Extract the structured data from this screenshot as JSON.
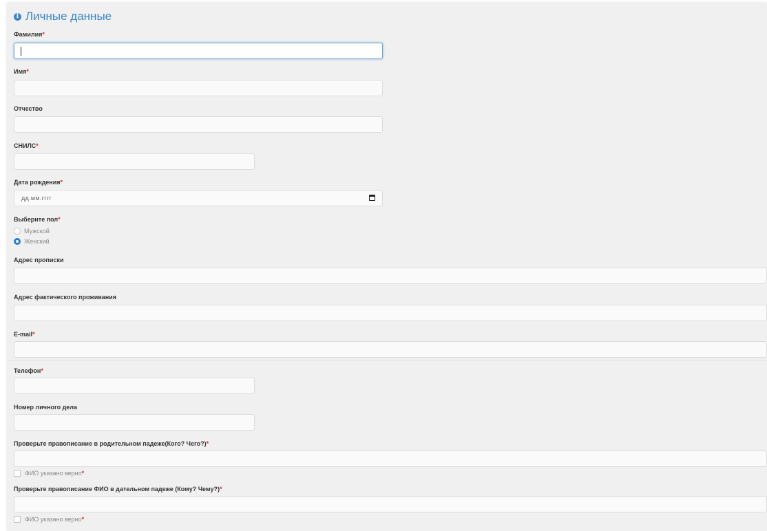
{
  "section": {
    "title": "Личные данные",
    "icon": "info-icon"
  },
  "required_mark": "*",
  "fields": {
    "last_name": {
      "label": "Фамилия",
      "value": ""
    },
    "first_name": {
      "label": "Имя",
      "value": ""
    },
    "patronymic": {
      "label": "Отчество",
      "value": ""
    },
    "snils": {
      "label": "СНИЛС",
      "value": ""
    },
    "birth_date": {
      "label": "Дата рождения",
      "placeholder": "дд.мм.гггг",
      "icon": "calendar-icon"
    },
    "gender": {
      "label": "Выберите пол",
      "options": [
        "Мужской",
        "Женский"
      ],
      "selected": "Женский"
    },
    "reg_address": {
      "label": "Адрес прописки",
      "value": ""
    },
    "actual_address": {
      "label": "Адрес фактического проживания",
      "value": ""
    },
    "email": {
      "label": "E-mail",
      "value": ""
    },
    "phone": {
      "label": "Телефон",
      "value": ""
    },
    "case_number": {
      "label": "Номер личного дела",
      "value": ""
    },
    "genitive": {
      "label": "Проверьте правописание в родительном падеже(Кого? Чего?)",
      "value": "",
      "checkbox_label": "ФИО указано верно"
    },
    "dative": {
      "label": "Проверьте правописание ФИО в дательном падеже (Кому? Чему?)",
      "value": "",
      "checkbox_label": "ФИО указано верно"
    }
  },
  "colors": {
    "accent": "#3a86c8",
    "required": "#d9262f",
    "radio_checked": "#2a7fd4",
    "panel_bg": "#f0f0f0"
  }
}
